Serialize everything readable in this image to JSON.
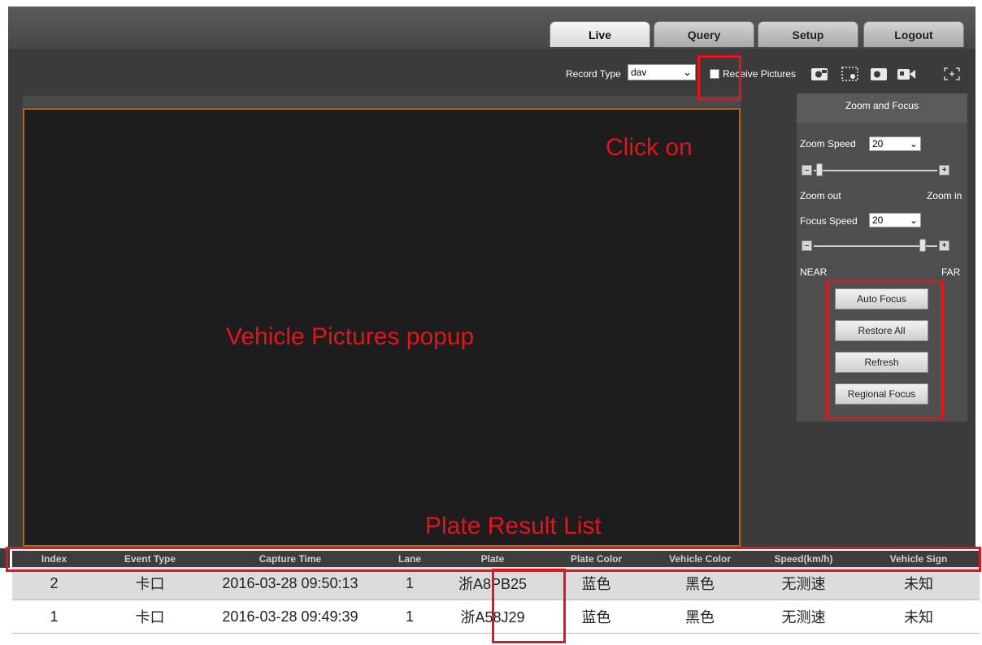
{
  "tabs": [
    {
      "label": "Live",
      "active": true
    },
    {
      "label": "Query"
    },
    {
      "label": "Setup"
    },
    {
      "label": "Logout"
    }
  ],
  "toolbar": {
    "record_type_label": "Record Type",
    "record_type_value": "dav",
    "receive_pictures_label": "Receive Pictures",
    "receive_pictures_checked": false,
    "icons": [
      "snapshot-icon",
      "manual-snap-icon",
      "capture-icon",
      "record-icon",
      "fullscreen-icon"
    ]
  },
  "zoom_focus": {
    "title": "Zoom and Focus",
    "zoom_speed_label": "Zoom",
    "speed_word": "Speed",
    "zoom_speed_value": "20",
    "zoom_level": 0.02,
    "zoom_out_label": "Zoom out",
    "zoom_in_label": "Zoom in",
    "focus_speed_label": "Focus",
    "focus_speed_value": "20",
    "focus_level": 0.9,
    "near_label": "NEAR",
    "far_label": "FAR",
    "buttons": [
      "Auto Focus",
      "Restore All",
      "Refresh",
      "Regional Focus"
    ]
  },
  "annotations": {
    "click_on": "Click on",
    "popup": "Vehicle Pictures popup",
    "result_list": "Plate Result  List",
    "color": "#e3141b"
  },
  "table": {
    "headers": [
      "Index",
      "Event Type",
      "Capture Time",
      "Lane",
      "Plate",
      "Plate Color",
      "Vehicle Color",
      "Speed(km/h)",
      "Vehicle Sign"
    ],
    "rows": [
      [
        "2",
        "卡口",
        "2016-03-28 09:50:13",
        "1",
        "浙A8PB25",
        "蓝色",
        "黑色",
        "无测速",
        "未知"
      ],
      [
        "1",
        "卡口",
        "2016-03-28 09:49:39",
        "1",
        "浙A58J29",
        "蓝色",
        "黑色",
        "无测速",
        "未知"
      ]
    ]
  },
  "colors": {
    "video_border": "#b3661d",
    "app_background": "#3b3b3b",
    "annotation_red": "#e3141b"
  }
}
